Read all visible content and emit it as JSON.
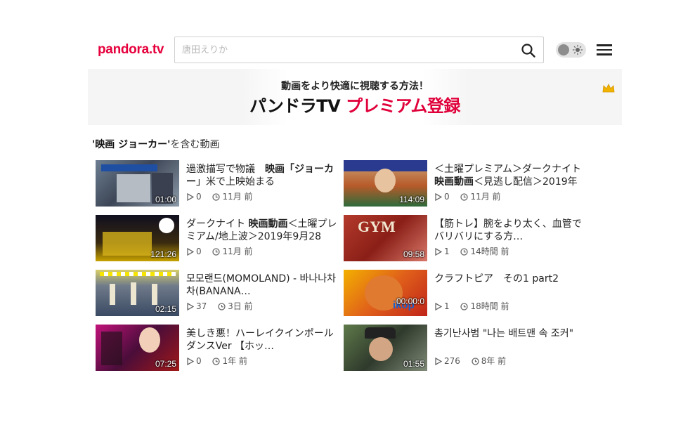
{
  "logo": {
    "brand": "pandora",
    "tld": ".tv"
  },
  "search": {
    "placeholder": "唐田えりか",
    "value": ""
  },
  "banner": {
    "line1": "動画をより快適に視聴する方法！",
    "line2a": "パンドラTV ",
    "line2b": "プレミアム登録"
  },
  "results": {
    "query": "'映画 ジョーカー'",
    "suffix": "を含む動画"
  },
  "videos": [
    {
      "title_pre": "過激描写で物議　",
      "title_bold": "映画「ジョーカー",
      "title_post": "」米で上映始まる",
      "views": "0",
      "time": "11月 前",
      "duration": "01:00"
    },
    {
      "title_pre": "＜土曜プレミアム＞ダークナイト ",
      "title_bold": "映画動画",
      "title_post": "＜見逃し配信＞2019年9…",
      "views": "0",
      "time": "11月 前",
      "duration": "114:09"
    },
    {
      "title_pre": "ダークナイト ",
      "title_bold": "映画動画",
      "title_post": "＜土曜プレミアム/地上波＞2019年9月28日…",
      "views": "0",
      "time": "11月 前",
      "duration": "121:26"
    },
    {
      "title_pre": "【筋トレ】腕をより太く、血管でバリバリにする方…",
      "title_bold": "",
      "title_post": "",
      "views": "1",
      "time": "14時間 前",
      "duration": "09:58"
    },
    {
      "title_pre": "모모랜드(MOMOLAND) - 바나나차차(BANANA…",
      "title_bold": "",
      "title_post": "",
      "views": "37",
      "time": "3日 前",
      "duration": "02:15"
    },
    {
      "title_pre": "クラフトピア　その1 part2",
      "title_bold": "",
      "title_post": "",
      "views": "1",
      "time": "18時間 前",
      "duration": "00:00:0"
    },
    {
      "title_pre": "美しき悪！ハーレイクインポールダンスVer 【ホッ…",
      "title_bold": "",
      "title_post": "",
      "views": "0",
      "time": "1年 前",
      "duration": "07:25"
    },
    {
      "title_pre": "총기난사범 \"나는 배트맨 속 조커\"",
      "title_bold": "",
      "title_post": "",
      "views": "276",
      "time": "8年 前",
      "duration": "01:55"
    }
  ]
}
